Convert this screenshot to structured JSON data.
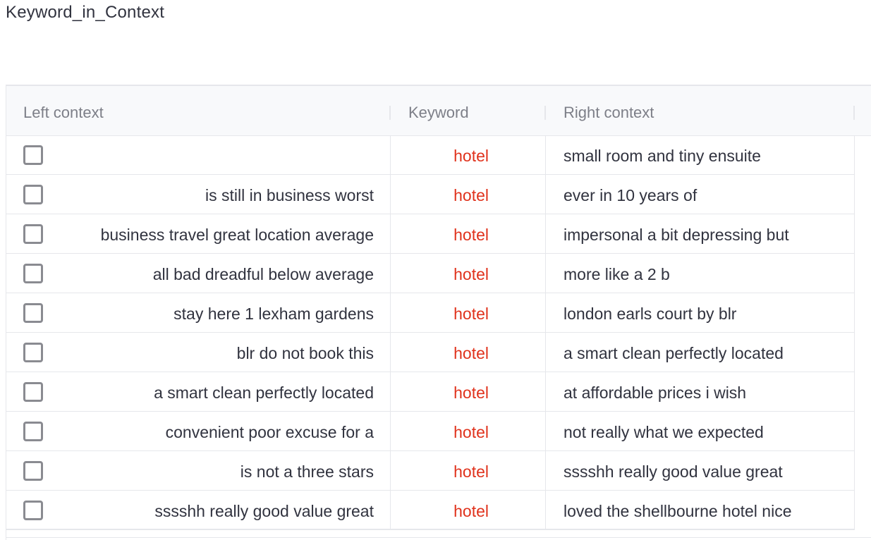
{
  "page": {
    "title": "Keyword_in_Context"
  },
  "table": {
    "columns": {
      "left": "Left context",
      "keyword": "Keyword",
      "right": "Right context"
    },
    "keyword_color": "#e0321c",
    "rows": [
      {
        "checked": false,
        "left": "",
        "keyword": "hotel",
        "right": "small room and tiny ensuite"
      },
      {
        "checked": false,
        "left": "is still in business worst",
        "keyword": "hotel",
        "right": "ever in 10 years of"
      },
      {
        "checked": false,
        "left": "business travel great location average",
        "keyword": "hotel",
        "right": "impersonal a bit depressing but"
      },
      {
        "checked": false,
        "left": "all bad dreadful below average",
        "keyword": "hotel",
        "right": "more like a 2 b"
      },
      {
        "checked": false,
        "left": "stay here 1 lexham gardens",
        "keyword": "hotel",
        "right": "london earls court by blr"
      },
      {
        "checked": false,
        "left": "blr do not book this",
        "keyword": "hotel",
        "right": "a smart clean perfectly located"
      },
      {
        "checked": false,
        "left": "a smart clean perfectly located",
        "keyword": "hotel",
        "right": "at affordable prices i wish"
      },
      {
        "checked": false,
        "left": "convenient poor excuse for a",
        "keyword": "hotel",
        "right": "not really what we expected"
      },
      {
        "checked": false,
        "left": "is not a three stars",
        "keyword": "hotel",
        "right": "sssshh really good value great"
      },
      {
        "checked": false,
        "left": "sssshh really good value great",
        "keyword": "hotel",
        "right": "loved the shellbourne hotel nice"
      }
    ]
  }
}
